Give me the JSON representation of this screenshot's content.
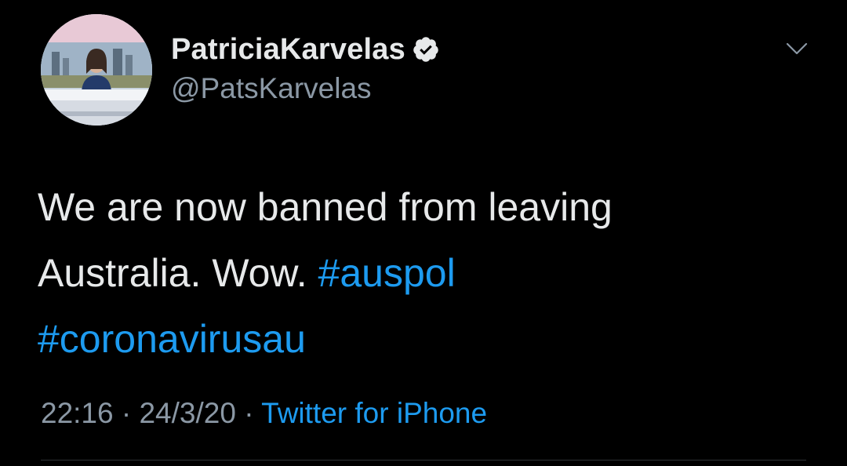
{
  "user": {
    "display_name": "PatriciaKarvelas",
    "handle": "@PatsKarvelas",
    "verified": true,
    "avatar_icon": "profile-photo"
  },
  "tweet": {
    "text_line1": "We are now banned from leaving",
    "text_line2_plain": "Australia. Wow. ",
    "hashtag1": "#auspol",
    "hashtag2": "#coronavirusau"
  },
  "meta": {
    "time": "22:16",
    "separator1": " · ",
    "date": "24/3/20",
    "separator2": " · ",
    "source": "Twitter for iPhone"
  },
  "colors": {
    "background": "#000000",
    "text": "#e7e9ea",
    "secondary": "#8b98a5",
    "accent": "#1d9bf0"
  },
  "icons": {
    "verified": "verified-badge-icon",
    "menu": "chevron-down-icon"
  }
}
